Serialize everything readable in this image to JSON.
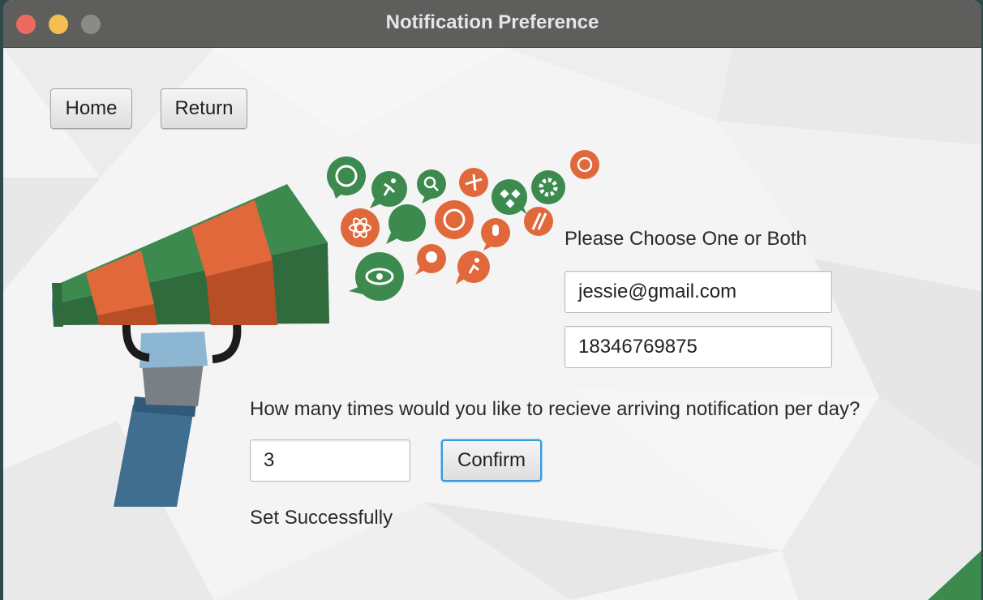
{
  "window": {
    "title": "Notification Preference"
  },
  "nav": {
    "home_label": "Home",
    "return_label": "Return"
  },
  "contact": {
    "prompt": "Please Choose One or Both",
    "email_value": "jessie@gmail.com",
    "phone_value": "18346769875"
  },
  "frequency": {
    "question": "How many times would you like to recieve arriving notification per day?",
    "value": "3",
    "confirm_label": "Confirm",
    "status": "Set Successfully"
  },
  "colors": {
    "green": "#3d8a4f",
    "orange": "#e0683a",
    "dark_green": "#2f6b3d",
    "sleeve_blue": "#3f6e8f",
    "glove_blue": "#8cb6d1",
    "confirm_focus": "#3a9ad9"
  },
  "icons": [
    "globe-icon",
    "runner-icon",
    "search-icon",
    "airplane-icon",
    "dropbox-icon",
    "gear-icon",
    "atom-icon",
    "chat-icon",
    "microphone-icon",
    "eye-icon",
    "palette-icon"
  ]
}
